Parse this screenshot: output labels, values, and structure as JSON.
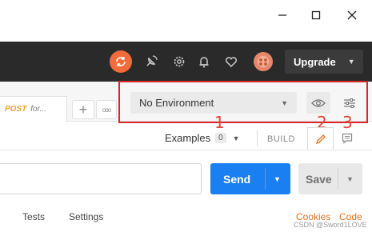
{
  "window": {
    "minimize_glyph": "—",
    "maximize_glyph": "☐",
    "close_glyph": "✕"
  },
  "header": {
    "icons": [
      "sync-icon",
      "satellite-icon",
      "gear-icon",
      "bell-icon",
      "heart-icon",
      "avatar"
    ],
    "upgrade_label": "Upgrade",
    "accent_color": "#f26b3a"
  },
  "tabs": {
    "active_tab": {
      "method": "POST",
      "name": "for..."
    },
    "add_glyph": "+",
    "more_glyph": "ooo"
  },
  "environment": {
    "selected": "No Environment"
  },
  "annotations": {
    "one": "1",
    "two": "2",
    "three": "3"
  },
  "request_bar": {
    "examples_label": "Examples",
    "examples_count": "0",
    "build_label": "BUILD"
  },
  "url_row": {
    "url_value": "",
    "send_label": "Send",
    "save_label": "Save",
    "send_color": "#1a7ff0"
  },
  "bottom_tabs": {
    "tests": "Tests",
    "settings": "Settings",
    "cookies": "Cookies",
    "code": "Code"
  },
  "watermark": "CSDN @Sword1LOVE"
}
